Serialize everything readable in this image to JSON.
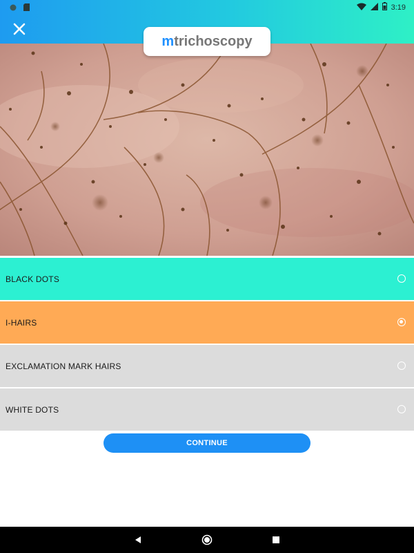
{
  "status_bar": {
    "time": "3:19"
  },
  "header": {
    "logo_prefix": "m",
    "logo_rest": "trichoscopy"
  },
  "options": [
    {
      "label": "BLACK DOTS",
      "bg": "#2cf0d2",
      "selected": false
    },
    {
      "label": "I-HAIRS",
      "bg": "#ffaa55",
      "selected": true
    },
    {
      "label": "EXCLAMATION MARK HAIRS",
      "bg": "#dcdcdc",
      "selected": false
    },
    {
      "label": "WHITE DOTS",
      "bg": "#dcdcdc",
      "selected": false
    }
  ],
  "continue_label": "CONTINUE",
  "colors": {
    "accent": "#1e90f5",
    "gradient_start": "#1e9bf0",
    "gradient_end": "#2ef0c6"
  },
  "icons": [
    "close-icon",
    "back-icon",
    "home-icon",
    "recents-icon",
    "wifi-icon",
    "signal-icon",
    "battery-icon"
  ]
}
